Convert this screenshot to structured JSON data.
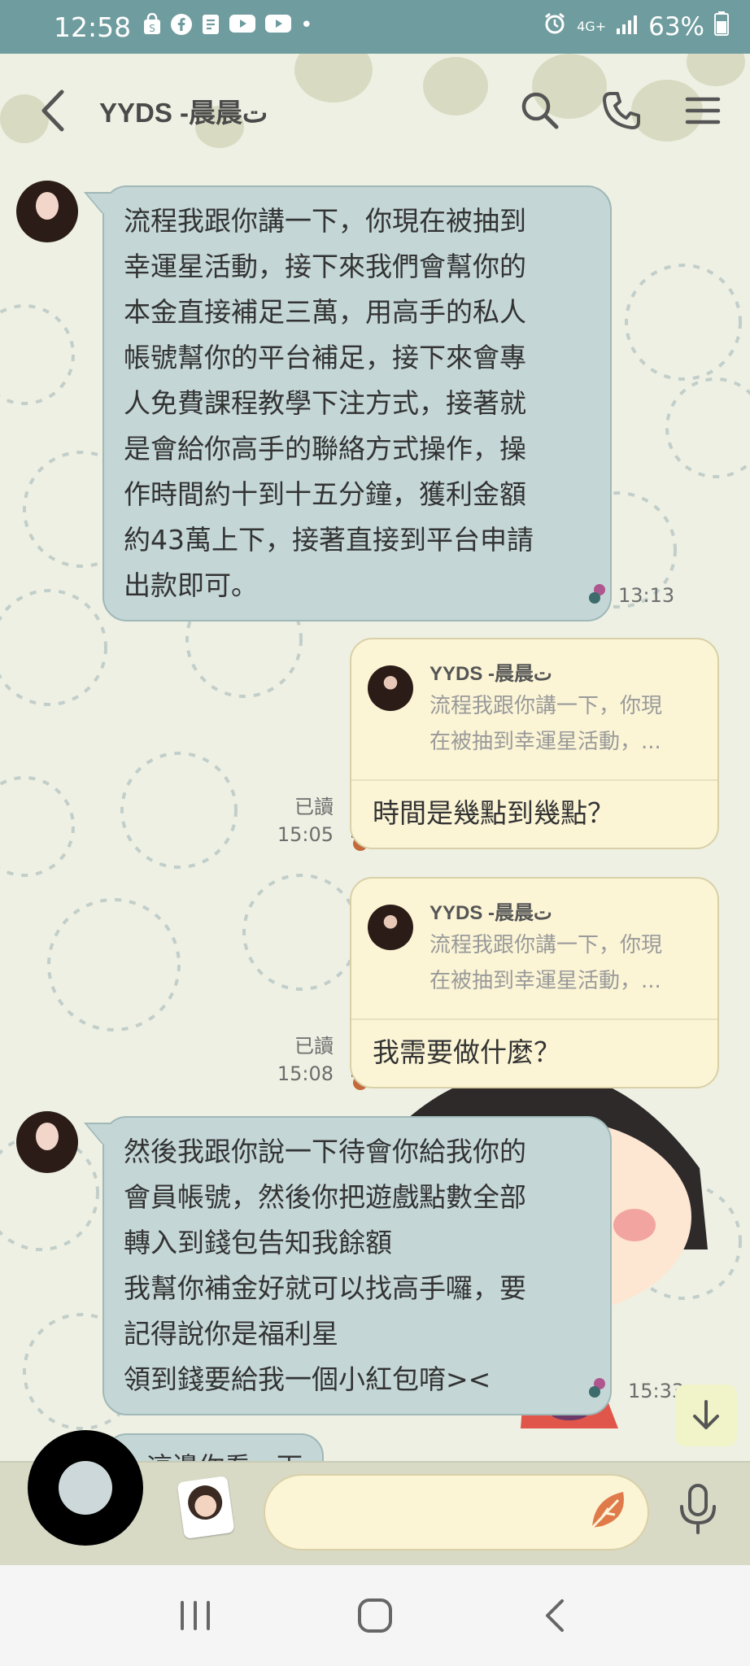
{
  "status_bar": {
    "time": "12:58",
    "dot": "•",
    "network": "4G+",
    "battery": "63%",
    "icons": [
      "shopping-bag-icon",
      "facebook-icon",
      "note-icon",
      "youtube-icon",
      "youtube-icon",
      "alarm-icon",
      "signal-icon",
      "battery-icon"
    ]
  },
  "header": {
    "title": "YYDS -晨晨ت"
  },
  "messages": [
    {
      "type": "incoming",
      "text": "流程我跟你講一下，你現在被抽到\n幸運星活動，接下來我們會幫你的\n本金直接補足三萬，用高手的私人\n帳號幫你的平台補足，接下來會專\n人免費課程教學下注方式，接著就\n是會給你高手的聯絡方式操作，操\n作時間約十到十五分鐘，獲利金額\n約43萬上下，接著直接到平台申請\n出款即可。",
      "time": "13:13"
    },
    {
      "type": "outgoing",
      "quote_name": "YYDS -晨晨ت",
      "quote_text": "流程我跟你講一下，你現\n在被抽到幸運星活動，...",
      "text": "時間是幾點到幾點？",
      "read": "已讀",
      "time": "15:05"
    },
    {
      "type": "outgoing",
      "quote_name": "YYDS -晨晨ت",
      "quote_text": "流程我跟你講一下，你現\n在被抽到幸運星活動，...",
      "text": "我需要做什麼？",
      "read": "已讀",
      "time": "15:08"
    },
    {
      "type": "incoming",
      "text": "然後我跟你說一下待會你給我你的\n會員帳號，然後你把遊戲點數全部\n轉入到錢包告知我餘額\n我幫你補金好就可以找高手囉，要\n記得說你是福利星\n領到錢要給我一個小紅包唷><",
      "time": "15:33"
    },
    {
      "type": "incoming_partial",
      "text": "這邊你看一下"
    }
  ],
  "input": {
    "placeholder": ""
  },
  "colors": {
    "status_bar": "#6f9c9e",
    "incoming_bubble": "#c4d6d6",
    "outgoing_bubble": "#fbf5d6",
    "background": "#eef0e3"
  }
}
